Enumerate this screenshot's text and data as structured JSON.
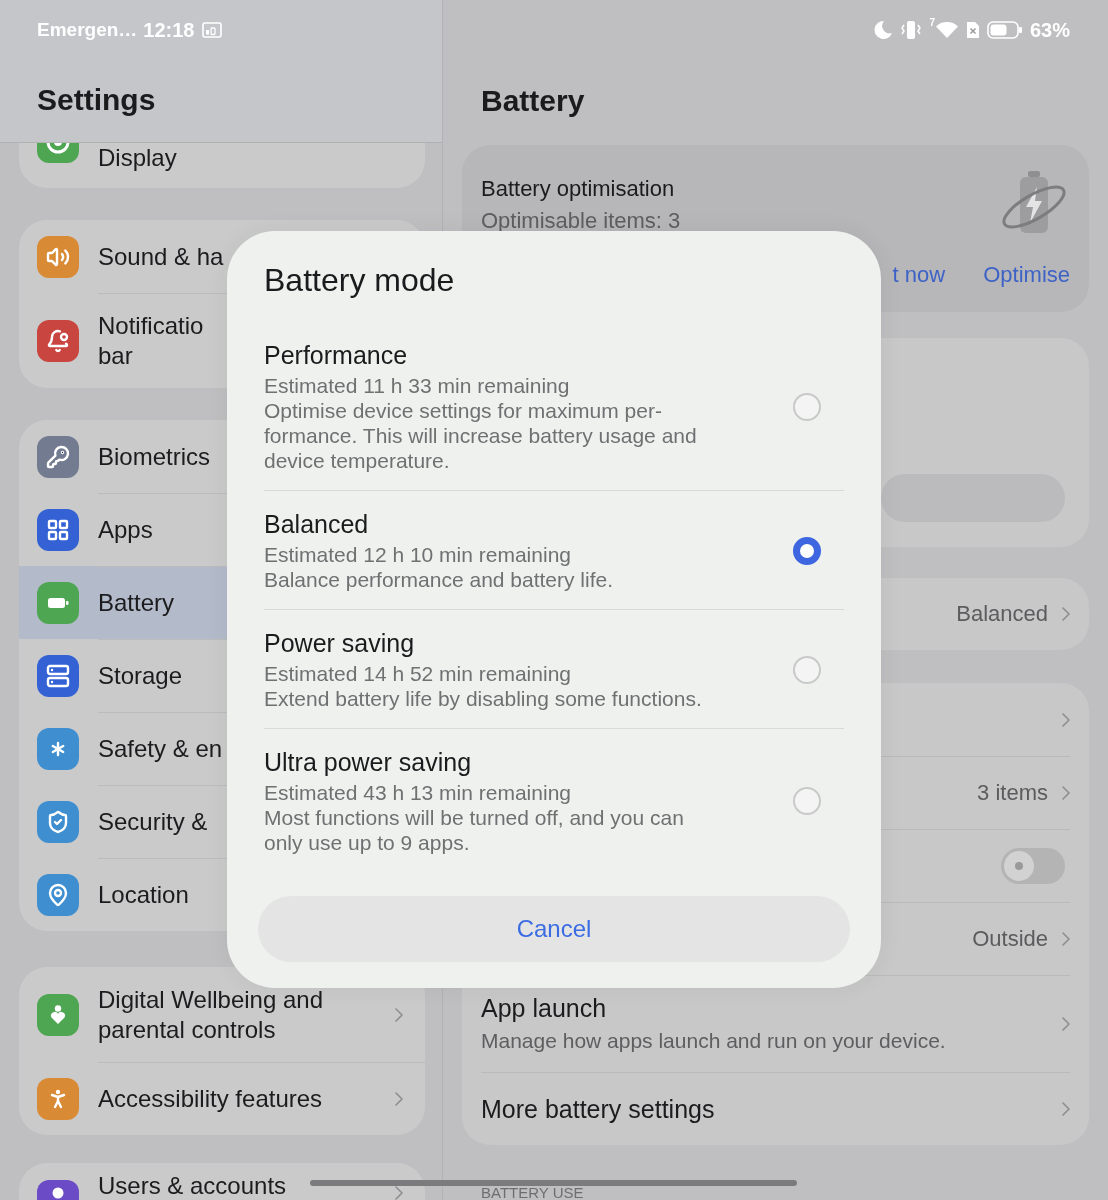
{
  "status_bar": {
    "left_text": "Emergen…",
    "time": "12:18",
    "wifi_label": "7",
    "battery_percent": "63%"
  },
  "sidebar": {
    "title": "Settings",
    "groups": [
      {
        "items": [
          {
            "lines": [
              "Display"
            ],
            "color": "#4ea552",
            "selected": false
          }
        ]
      },
      {
        "items": [
          {
            "lines": [
              "Sound & ha"
            ],
            "color": "#d88a35",
            "selected": false
          },
          {
            "lines": [
              "Notificatio",
              "bar"
            ],
            "color": "#c9453f",
            "selected": false
          }
        ]
      },
      {
        "items": [
          {
            "lines": [
              "Biometrics"
            ],
            "color": "#727b90",
            "selected": false
          },
          {
            "lines": [
              "Apps"
            ],
            "color": "#3462d4",
            "selected": false
          },
          {
            "lines": [
              "Battery"
            ],
            "color": "#4ea552",
            "selected": true
          },
          {
            "lines": [
              "Storage"
            ],
            "color": "#3462d4",
            "selected": false
          },
          {
            "lines": [
              "Safety & en"
            ],
            "color": "#3f8fd0",
            "selected": false
          },
          {
            "lines": [
              "Security &"
            ],
            "color": "#3f8fd0",
            "selected": false
          },
          {
            "lines": [
              "Location"
            ],
            "color": "#3f8fd0",
            "selected": false
          }
        ]
      },
      {
        "items": [
          {
            "lines": [
              "Digital Wellbeing and",
              "parental controls"
            ],
            "color": "#4ea552",
            "selected": false,
            "chevron": true
          },
          {
            "lines": [
              "Accessibility features"
            ],
            "color": "#d88a35",
            "selected": false,
            "chevron": true
          }
        ]
      },
      {
        "items": [
          {
            "lines": [
              "Users & accounts"
            ],
            "color": "#6b4bc6",
            "selected": false,
            "chevron": true
          }
        ]
      }
    ]
  },
  "detail": {
    "title": "Battery",
    "optimisation": {
      "title": "Battery optimisation",
      "subtitle": "Optimisable items: 3",
      "actions": [
        "t now",
        "Optimise"
      ]
    },
    "mode": {
      "value": "Balanced"
    },
    "rows": [
      {
        "kind": "link"
      },
      {
        "kind": "link",
        "value": "3 items"
      },
      {
        "kind": "toggle",
        "on": false
      },
      {
        "kind": "link",
        "value": "Outside"
      },
      {
        "kind": "link",
        "title": "App launch",
        "subtitle": "Manage how apps launch and run on your device."
      },
      {
        "kind": "link",
        "title": "More battery settings"
      }
    ],
    "section_label": "BATTERY USE"
  },
  "dialog": {
    "title": "Battery mode",
    "options": [
      {
        "title": "Performance",
        "estimate": "Estimated 11 h 33 min remaining",
        "description": [
          "Optimise device settings for maximum per-",
          "formance. This will increase battery usage and",
          "device temperature."
        ],
        "selected": false
      },
      {
        "title": "Balanced",
        "estimate": "Estimated 12 h 10 min remaining",
        "description": [
          "Balance performance and battery life."
        ],
        "selected": true
      },
      {
        "title": "Power saving",
        "estimate": "Estimated 14 h 52 min remaining",
        "description": [
          "Extend battery life by disabling some functions."
        ],
        "selected": false
      },
      {
        "title": "Ultra power saving",
        "estimate": "Estimated 43 h 13 min remaining",
        "description": [
          "Most functions will be turned off, and you can",
          "only use up to 9 apps."
        ],
        "selected": false
      }
    ],
    "cancel": "Cancel"
  }
}
